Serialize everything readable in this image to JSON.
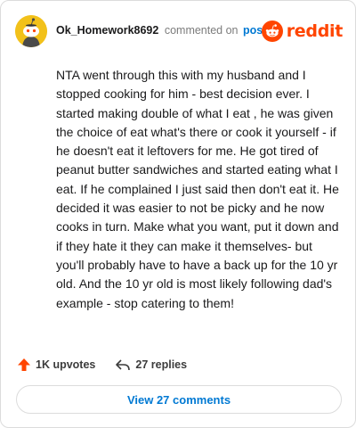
{
  "header": {
    "username": "Ok_Homework8692",
    "commented_text": "commented on",
    "post_link": "post",
    "brand": "reddit"
  },
  "comment": {
    "body": "NTA went through this with my husband and I stopped cooking for him - best decision ever. I started making double of what I eat , he was given the choice of eat what's there or cook it yourself - if he doesn't eat it leftovers for me. He got tired of peanut butter sandwiches and started eating what I eat. If he complained I just said then don't eat it. He decided it was easier to not be picky and he now cooks in turn. Make what you want, put it down and if they hate it they can make it themselves- but you'll probably have to have a back up for the 10 yr old. And the 10 yr old is most likely following dad's example - stop catering to them!"
  },
  "actions": {
    "upvotes": "1K upvotes",
    "replies": "27 replies"
  },
  "view_button": "View 27 comments",
  "colors": {
    "brand": "#ff4500",
    "link": "#0079d3",
    "upvote": "#ff4500",
    "avatar": "#f2c11a"
  },
  "icons": {
    "avatar": "snoo-avatar",
    "brand_logo": "reddit-alien-icon",
    "upvote": "upvote-arrow-icon",
    "reply": "reply-arrow-icon"
  }
}
